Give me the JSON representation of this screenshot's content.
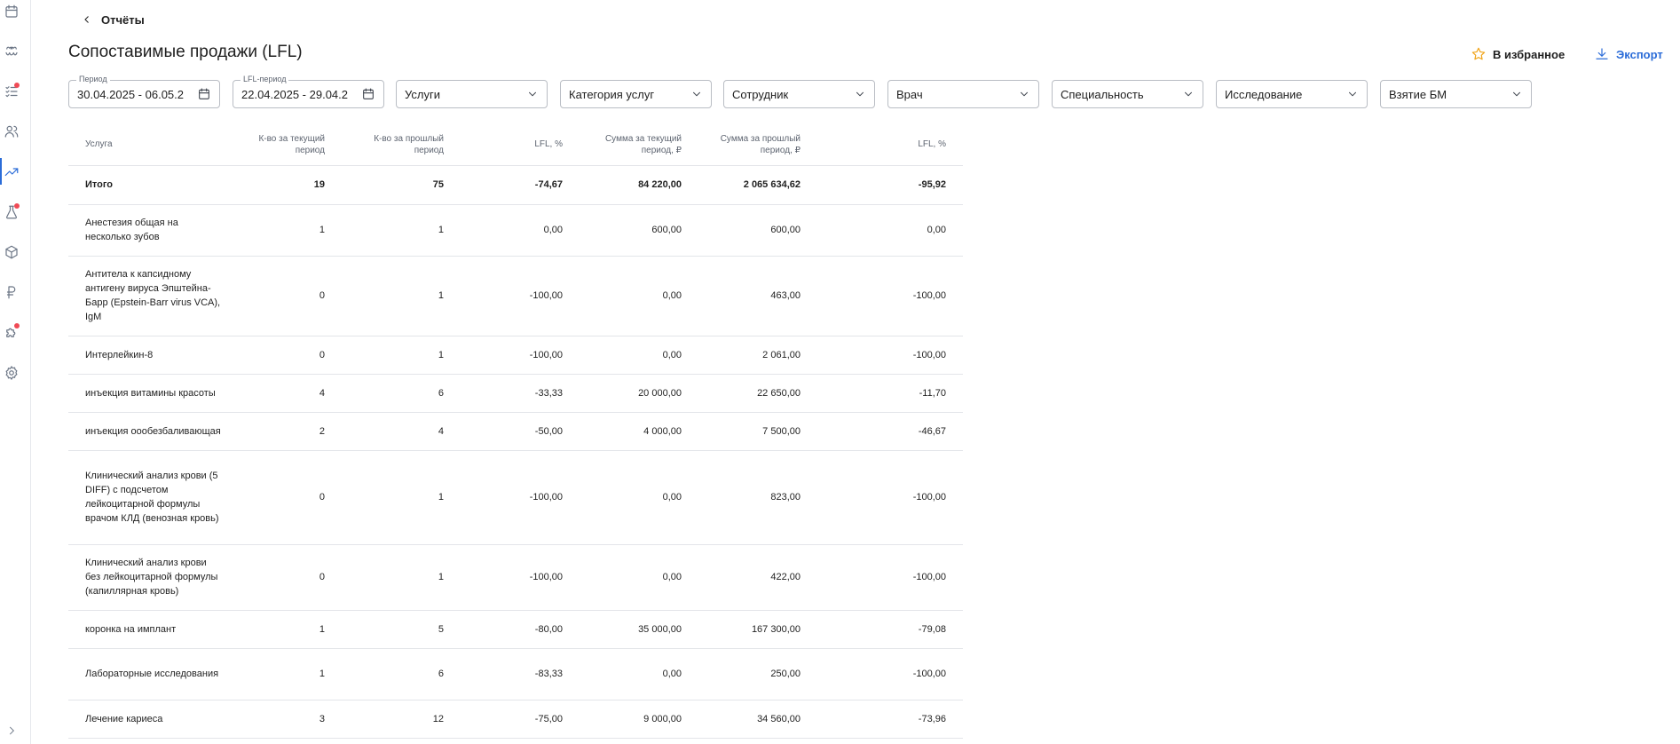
{
  "nav": {
    "back_label": "Отчёты"
  },
  "page": {
    "title": "Сопоставимые продажи (LFL)",
    "favorite_label": "В избранное",
    "export_label": "Экспорт"
  },
  "filters": {
    "period": {
      "label": "Период",
      "value": "30.04.2025 - 06.05.2"
    },
    "lfl_period": {
      "label": "LFL-период",
      "value": "22.04.2025 - 29.04.2"
    },
    "services": "Услуги",
    "service_category": "Категория услуг",
    "employee": "Сотрудник",
    "doctor": "Врач",
    "specialty": "Специальность",
    "research": "Исследование",
    "bm_sampling": "Взятие БМ"
  },
  "table": {
    "columns": [
      "Услуга",
      "К-во за текущий период",
      "К-во за прошлый период",
      "LFL, %",
      "Сумма за текущий период, ₽",
      "Сумма за прошлый период, ₽",
      "LFL, %"
    ],
    "total": [
      "Итого",
      "19",
      "75",
      "-74,67",
      "84 220,00",
      "2 065 634,62",
      "-95,92"
    ],
    "rows": [
      [
        "Анестезия общая на несколько зубов",
        "1",
        "1",
        "0,00",
        "600,00",
        "600,00",
        "0,00"
      ],
      [
        "Антитела к капсидному антигену вируса Эпштейна-Барр (Epstein-Barr virus VCA), IgM",
        "0",
        "1",
        "-100,00",
        "0,00",
        "463,00",
        "-100,00"
      ],
      [
        "Интерлейкин-8",
        "0",
        "1",
        "-100,00",
        "0,00",
        "2 061,00",
        "-100,00"
      ],
      [
        "инъекция витамины красоты",
        "4",
        "6",
        "-33,33",
        "20 000,00",
        "22 650,00",
        "-11,70"
      ],
      [
        "инъекция оообезбаливающая",
        "2",
        "4",
        "-50,00",
        "4 000,00",
        "7 500,00",
        "-46,67"
      ],
      [
        "Клинический анализ крови (5 DIFF) с подсчетом лейкоцитарной формулы врачом КЛД (венозная кровь)",
        "0",
        "1",
        "-100,00",
        "0,00",
        "823,00",
        "-100,00"
      ],
      [
        "Клинический анализ крови без лейкоцитарной формулы (капиллярная кровь)",
        "0",
        "1",
        "-100,00",
        "0,00",
        "422,00",
        "-100,00"
      ],
      [
        "коронка на имплант",
        "1",
        "5",
        "-80,00",
        "35 000,00",
        "167 300,00",
        "-79,08"
      ],
      [
        "Лабораторные исследования",
        "1",
        "6",
        "-83,33",
        "0,00",
        "250,00",
        "-100,00"
      ],
      [
        "Лечение кариеса",
        "3",
        "12",
        "-75,00",
        "9 000,00",
        "34 560,00",
        "-73,96"
      ]
    ]
  },
  "colors": {
    "accent": "#2b6cd8",
    "star": "#f0a41a",
    "notification_dot": "#f04b56"
  }
}
